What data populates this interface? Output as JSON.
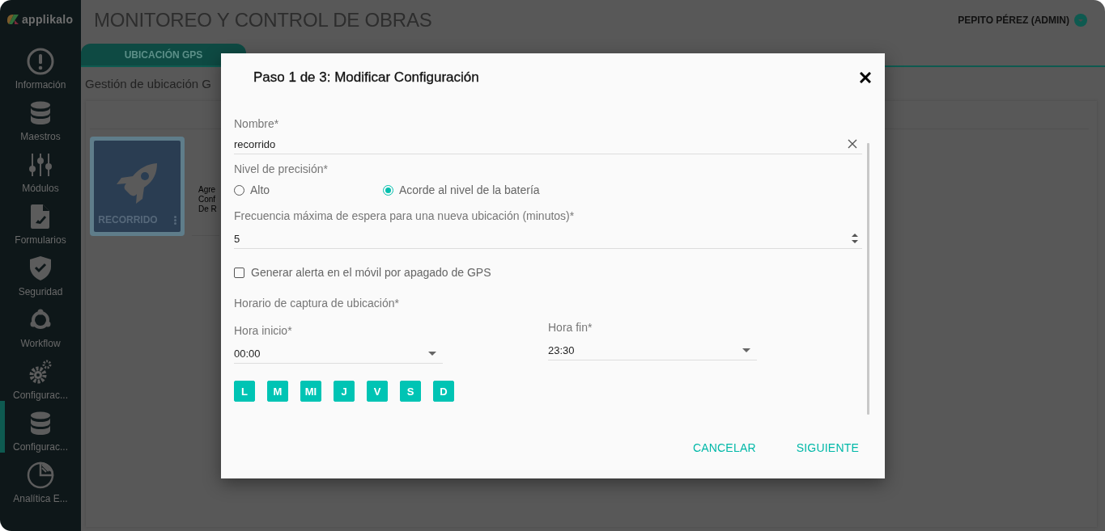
{
  "sidebar": {
    "logo": "applikalo",
    "items": [
      {
        "label": "Información",
        "selected": false
      },
      {
        "label": "Maestros",
        "selected": false
      },
      {
        "label": "Módulos",
        "selected": false
      },
      {
        "label": "Formularios",
        "selected": false
      },
      {
        "label": "Seguridad",
        "selected": false
      },
      {
        "label": "Workflow",
        "selected": false
      },
      {
        "label": "Configurac...",
        "selected": false
      },
      {
        "label": "Configurac...",
        "selected": true
      },
      {
        "label": "Analítica E...",
        "selected": false
      }
    ]
  },
  "header": {
    "title": "MONITOREO Y CONTROL DE OBRAS",
    "user": "PEPITO PÉREZ (ADMIN)"
  },
  "tabs": [
    {
      "label": "UBICACIÓN GPS",
      "selected": true
    }
  ],
  "section_title": "Gestión de ubicación G",
  "cards": [
    {
      "title": "RECORRIDO"
    }
  ],
  "card_text": [
    "Agre",
    "Conf",
    "De R"
  ],
  "dialog": {
    "title": "Paso 1 de 3: Modificar Configuración",
    "name_field": {
      "label": "Nombre*",
      "value": "recorrido"
    },
    "precision": {
      "label": "Nivel de precisión*",
      "options": [
        {
          "label": "Alto",
          "selected": false
        },
        {
          "label": "Acorde al nivel de la batería",
          "selected": true
        }
      ]
    },
    "frequency_field": {
      "label": "Frecuencia máxima de espera para una nueva ubicación (minutos)*",
      "value": "5"
    },
    "gps_alert": {
      "label": "Generar alerta en el móvil por apagado de GPS",
      "checked": false
    },
    "schedule_label": "Horario de captura de ubicación*",
    "start_field": {
      "label": "Hora inicio*",
      "value": "00:00"
    },
    "end_field": {
      "label": "Hora fin*",
      "value": "23:30"
    },
    "days": [
      {
        "label": "L",
        "selected": true
      },
      {
        "label": "M",
        "selected": true
      },
      {
        "label": "MI",
        "selected": true
      },
      {
        "label": "J",
        "selected": true
      },
      {
        "label": "V",
        "selected": true
      },
      {
        "label": "S",
        "selected": true
      },
      {
        "label": "D",
        "selected": true
      }
    ],
    "buttons": [
      "CANCELAR",
      "SIGUIENTE"
    ]
  }
}
